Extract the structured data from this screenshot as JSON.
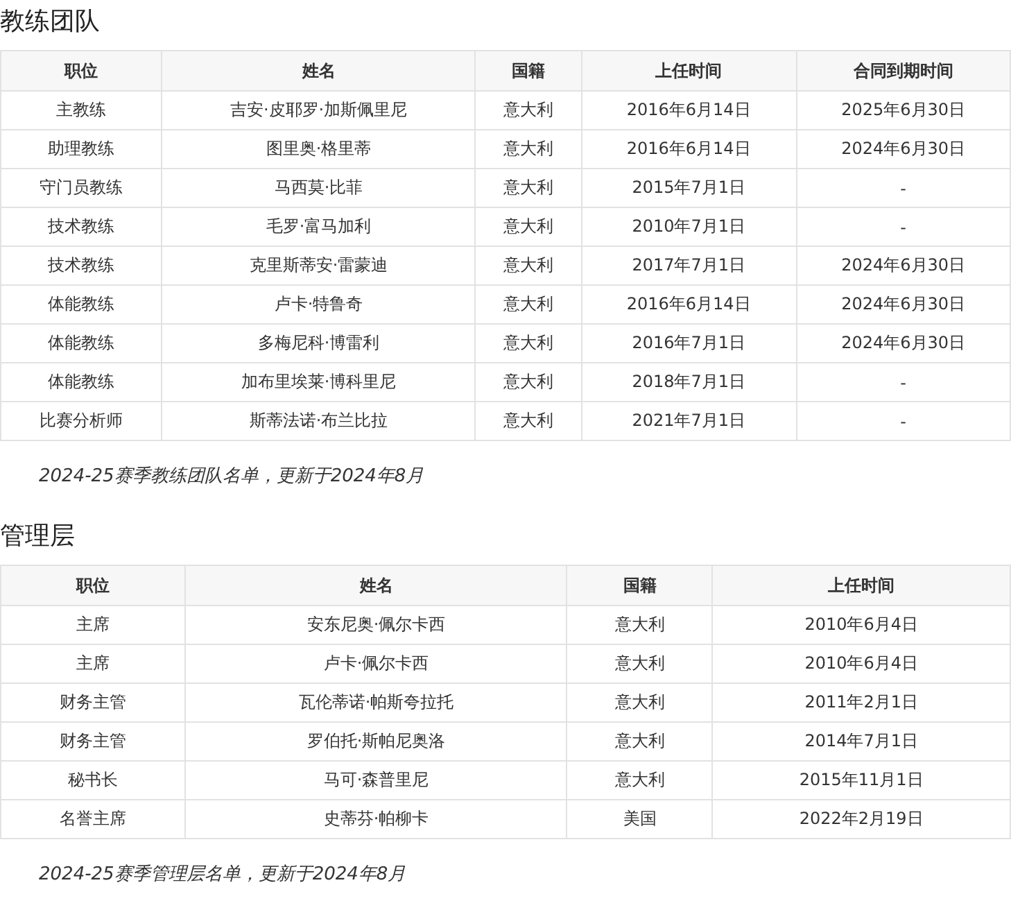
{
  "sections": [
    {
      "title": "教练团队",
      "columns": [
        "职位",
        "姓名",
        "国籍",
        "上任时间",
        "合同到期时间"
      ],
      "rows": [
        [
          "主教练",
          "吉安·皮耶罗·加斯佩里尼",
          "意大利",
          "2016年6月14日",
          "2025年6月30日"
        ],
        [
          "助理教练",
          "图里奥·格里蒂",
          "意大利",
          "2016年6月14日",
          "2024年6月30日"
        ],
        [
          "守门员教练",
          "马西莫·比菲",
          "意大利",
          "2015年7月1日",
          "-"
        ],
        [
          "技术教练",
          "毛罗·富马加利",
          "意大利",
          "2010年7月1日",
          "-"
        ],
        [
          "技术教练",
          "克里斯蒂安·雷蒙迪",
          "意大利",
          "2017年7月1日",
          "2024年6月30日"
        ],
        [
          "体能教练",
          "卢卡·特鲁奇",
          "意大利",
          "2016年6月14日",
          "2024年6月30日"
        ],
        [
          "体能教练",
          "多梅尼科·博雷利",
          "意大利",
          "2016年7月1日",
          "2024年6月30日"
        ],
        [
          "体能教练",
          "加布里埃莱·博科里尼",
          "意大利",
          "2018年7月1日",
          "-"
        ],
        [
          "比赛分析师",
          "斯蒂法诺·布兰比拉",
          "意大利",
          "2021年7月1日",
          "-"
        ]
      ],
      "caption": "2024-25赛季教练团队名单，更新于2024年8月"
    },
    {
      "title": "管理层",
      "columns": [
        "职位",
        "姓名",
        "国籍",
        "上任时间"
      ],
      "rows": [
        [
          "主席",
          "安东尼奥·佩尔卡西",
          "意大利",
          "2010年6月4日"
        ],
        [
          "主席",
          "卢卡·佩尔卡西",
          "意大利",
          "2010年6月4日"
        ],
        [
          "财务主管",
          "瓦伦蒂诺·帕斯夸拉托",
          "意大利",
          "2011年2月1日"
        ],
        [
          "财务主管",
          "罗伯托·斯帕尼奥洛",
          "意大利",
          "2014年7月1日"
        ],
        [
          "秘书长",
          "马可·森普里尼",
          "意大利",
          "2015年11月1日"
        ],
        [
          "名誉主席",
          "史蒂芬·帕柳卡",
          "美国",
          "2022年2月19日"
        ]
      ],
      "caption": "2024-25赛季管理层名单，更新于2024年8月"
    }
  ]
}
